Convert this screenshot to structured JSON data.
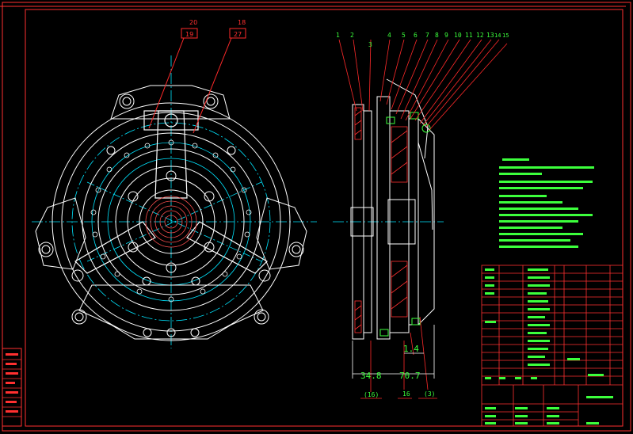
{
  "front_view": {
    "callouts": [
      {
        "id": "callout-20",
        "label": "20"
      },
      {
        "id": "callout-18",
        "label": "18"
      }
    ],
    "boxed_labels": [
      {
        "id": "box-19",
        "label": "19"
      },
      {
        "id": "box-27",
        "label": "27"
      }
    ]
  },
  "section_view": {
    "part_numbers": [
      "1",
      "2",
      "3",
      "4",
      "5",
      "6",
      "7",
      "8",
      "9",
      "10",
      "11",
      "12",
      "13",
      "14",
      "15"
    ],
    "dimensions": {
      "d1": "1.4",
      "d2": "34.8",
      "d3": "70.7"
    },
    "bottom_labels": {
      "b1": "(16)",
      "b2": "16",
      "b3": "(3)"
    }
  },
  "colors": {
    "outline": "#ffffff",
    "center_line": "#00e5ff",
    "leader": "#ff2a2a",
    "text": "#3cff3c",
    "border": "#ff3030",
    "background": "#000000"
  }
}
